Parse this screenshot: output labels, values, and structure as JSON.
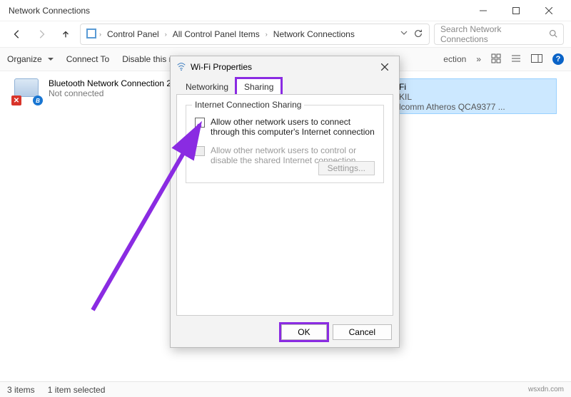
{
  "window": {
    "title": "Network Connections"
  },
  "breadcrumb": {
    "items": [
      "Control Panel",
      "All Control Panel Items",
      "Network Connections"
    ]
  },
  "search": {
    "placeholder": "Search Network Connections"
  },
  "toolbar": {
    "organize": "Organize",
    "connect_to": "Connect To",
    "disable": "Disable this n",
    "ection": "ection",
    "more": "»"
  },
  "connections": {
    "bluetooth": {
      "name": "Bluetooth Network Connection 2",
      "status": "Not connected"
    },
    "wifi": {
      "name": "Fi",
      "line2": "KIL",
      "adapter": "lcomm Atheros QCA9377 ..."
    }
  },
  "dialog": {
    "title": "Wi-Fi Properties",
    "tabs": {
      "networking": "Networking",
      "sharing": "Sharing"
    },
    "group_title": "Internet Connection Sharing",
    "chk1": "Allow other network users to connect through this computer's Internet connection",
    "chk2": "Allow other network users to control or disable the shared Internet connection",
    "settings_btn": "Settings...",
    "ok": "OK",
    "cancel": "Cancel"
  },
  "status": {
    "count": "3 items",
    "selected": "1 item selected",
    "watermark": "wsxdn.com"
  }
}
